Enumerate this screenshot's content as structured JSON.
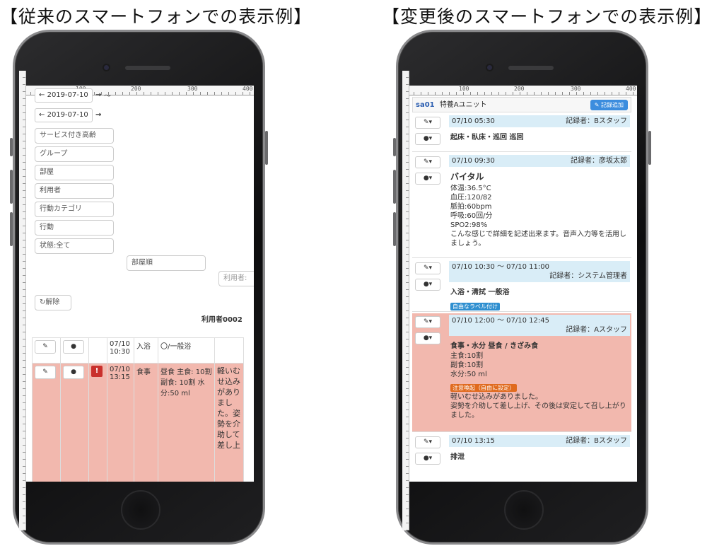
{
  "captions": {
    "left": "【従来のスマートフォンでの表示例】",
    "right": "【変更後のスマートフォンでの表示例】"
  },
  "ruler": {
    "ticks": [
      "100",
      "200",
      "300",
      "400"
    ]
  },
  "old_ui": {
    "date_from": "2019-07-10",
    "date_to": "2019-07-10",
    "range_sep": "〜",
    "arrow_prev": "←",
    "arrow_next": "→",
    "filters": [
      "サービス付き高齢",
      "グループ",
      "部屋",
      "利用者",
      "行動カテゴリ",
      "行動",
      "状態:全て"
    ],
    "sort_label": "部屋順",
    "user_search_placeholder": "利用者:",
    "clear_label": "↻解除",
    "user_name": "利用者0002",
    "rows": [
      {
        "time": "07/10 10:30",
        "category": "入浴",
        "detail": "〇/一般浴",
        "note": ""
      },
      {
        "time": "07/10 13:15",
        "category": "食事",
        "detail": "昼食 主食: 10割 副食: 10割 水分:50 ml",
        "note": "軽いむせ込みがありました。姿勢を介助して差し上"
      }
    ],
    "edit_icon": "✎",
    "comment_icon": "●",
    "alert_icon": "!"
  },
  "new_ui": {
    "unit_id": "sa01",
    "unit_name": "特養Aユニット",
    "add_button": "✎ 記録追加",
    "edit_icon": "✎▾",
    "comment_icon": "●▾",
    "records": [
      {
        "head": "07/10 05:30",
        "recorder": "記録者：Bスタッフ",
        "title": "起床・臥床・巡回 巡回",
        "text": [],
        "tags": [],
        "alert": false
      },
      {
        "head": "07/10 09:30",
        "recorder": "記録者：彦坂太郎",
        "title": "バイタル",
        "text": [
          "体温:36.5°C",
          "血圧:120/82",
          "脈拍:60bpm",
          "呼吸:60回/分",
          "SPO2:98%",
          "こんな感じで詳細を記述出来ます。音声入力等を活用しましょう。"
        ],
        "tags": [],
        "alert": false
      },
      {
        "head": "07/10 10:30 〜 07/10 11:00",
        "recorder": "記録者：システム管理者",
        "title": "入浴・清拭 一般浴",
        "text": [],
        "tags": [
          "自由なラベル付け"
        ],
        "alert": false
      },
      {
        "head": "07/10 12:00 〜 07/10 12:45",
        "recorder": "記録者：Aスタッフ",
        "title": "食事・水分 昼食 / きざみ食",
        "text": [
          "主食:10割",
          "副食:10割",
          "水分:50 ml"
        ],
        "tags": [
          "注意喚起（自由に設定）"
        ],
        "text2": [
          "軽いむせ込みがありました。",
          "姿勢を介助して差し上げ、その後は安定して召し上がりました。"
        ],
        "alert": true
      },
      {
        "head": "07/10 13:15",
        "recorder": "記録者：Bスタッフ",
        "title": "排泄",
        "text": [],
        "tags": [],
        "alert": false
      }
    ]
  },
  "colors": {
    "alert_bg": "#f2b8ae",
    "head_bg": "#d9edf7",
    "add_btn": "#3c8dde",
    "tag_blue": "#2f8fd0",
    "tag_orange": "#e06a1e"
  }
}
